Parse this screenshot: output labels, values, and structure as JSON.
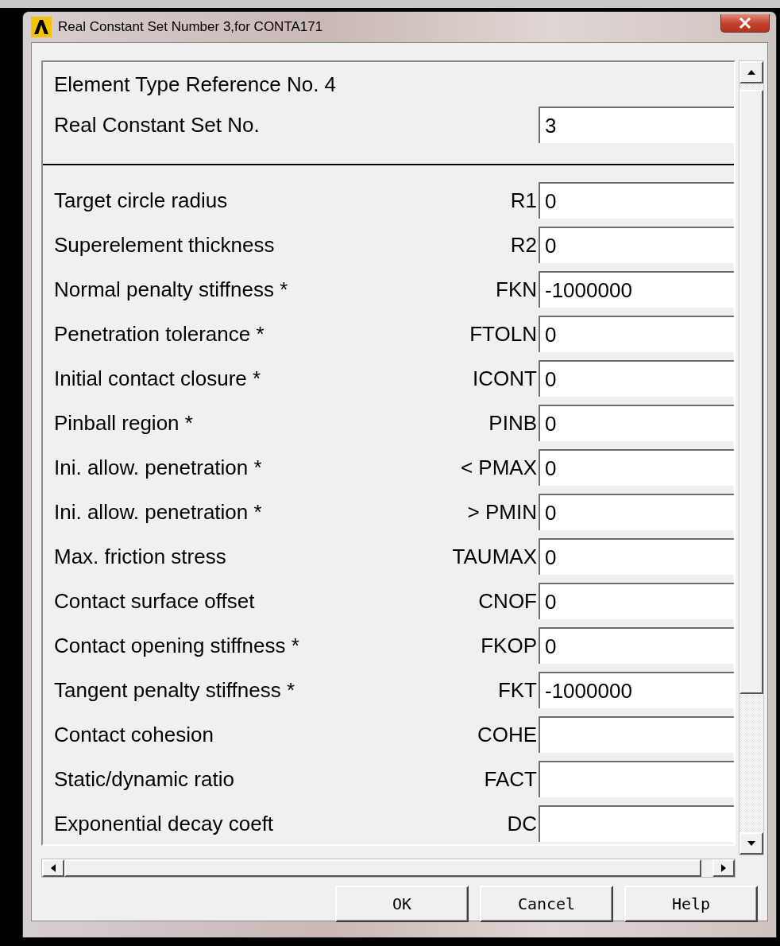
{
  "window": {
    "title": "Real Constant Set Number 3,for CONTA171"
  },
  "header": {
    "element_type": "Element Type Reference No. 4",
    "set_label": "Real Constant Set No.",
    "set_value": "3"
  },
  "rows": [
    {
      "label": "Target circle radius",
      "param": "R1",
      "value": "0"
    },
    {
      "label": "Superelement thickness",
      "param": "R2",
      "value": "0"
    },
    {
      "label": "Normal penalty stiffness *",
      "param": "FKN",
      "value": "-1000000"
    },
    {
      "label": "Penetration tolerance *",
      "param": "FTOLN",
      "value": "0"
    },
    {
      "label": "Initial contact closure *",
      "param": "ICONT",
      "value": "0"
    },
    {
      "label": "Pinball region *",
      "param": "PINB",
      "value": "0"
    },
    {
      "label": "Ini. allow. penetration *",
      "param": "< PMAX",
      "value": "0"
    },
    {
      "label": "Ini. allow. penetration *",
      "param": "> PMIN",
      "value": "0"
    },
    {
      "label": "Max. friction stress",
      "param": "TAUMAX",
      "value": "0"
    },
    {
      "label": "Contact surface offset",
      "param": "CNOF",
      "value": "0"
    },
    {
      "label": "Contact opening stiffness *",
      "param": "FKOP",
      "value": "0"
    },
    {
      "label": "Tangent penalty stiffness *",
      "param": "FKT",
      "value": "-1000000"
    },
    {
      "label": "Contact cohesion",
      "param": "COHE"
    },
    {
      "label": "Static/dynamic ratio",
      "param": "FACT"
    },
    {
      "label": "Exponential decay coeft",
      "param": "DC"
    }
  ],
  "buttons": [
    "OK",
    "Cancel",
    "Help"
  ]
}
